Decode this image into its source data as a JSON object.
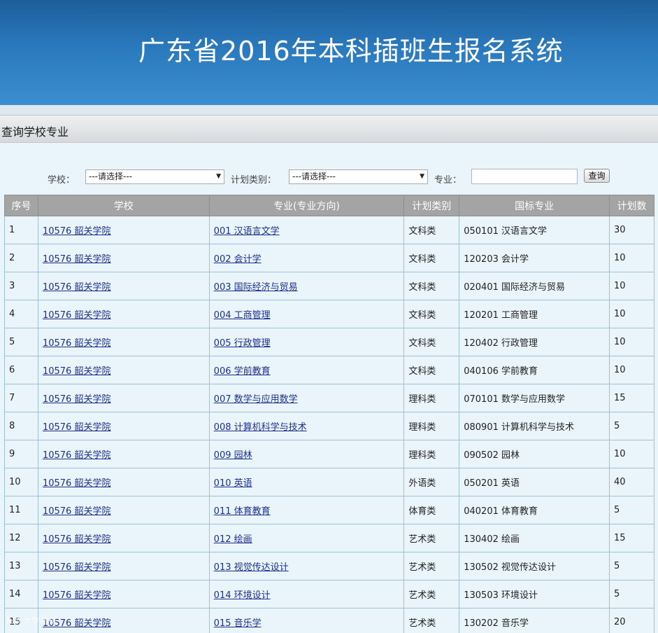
{
  "header": {
    "title": "广东省2016年本科插班生报名系统"
  },
  "section": {
    "title": "查询学校专业"
  },
  "search": {
    "school_label": "学校：",
    "school_value": "---请选择---",
    "plan_type_label": "计划类别：",
    "plan_type_value": "---请选择---",
    "major_label": "专业：",
    "major_value": "",
    "query_button": "查询"
  },
  "table": {
    "columns": [
      "序号",
      "学校",
      "专业(专业方向)",
      "计划类别",
      "国标专业",
      "计划数"
    ],
    "rows": [
      {
        "no": "1",
        "school": "10576 韶关学院",
        "major": "001 汉语言文学",
        "category": "文科类",
        "national": "050101 汉语言文学",
        "plan": "30"
      },
      {
        "no": "2",
        "school": "10576 韶关学院",
        "major": "002 会计学",
        "category": "文科类",
        "national": "120203 会计学",
        "plan": "10"
      },
      {
        "no": "3",
        "school": "10576 韶关学院",
        "major": "003 国际经济与贸易",
        "category": "文科类",
        "national": "020401 国际经济与贸易",
        "plan": "10"
      },
      {
        "no": "4",
        "school": "10576 韶关学院",
        "major": "004 工商管理",
        "category": "文科类",
        "national": "120201 工商管理",
        "plan": "10"
      },
      {
        "no": "5",
        "school": "10576 韶关学院",
        "major": "005 行政管理",
        "category": "文科类",
        "national": "120402 行政管理",
        "plan": "10"
      },
      {
        "no": "6",
        "school": "10576 韶关学院",
        "major": "006 学前教育",
        "category": "文科类",
        "national": "040106 学前教育",
        "plan": "10"
      },
      {
        "no": "7",
        "school": "10576 韶关学院",
        "major": "007 数学与应用数学",
        "category": "理科类",
        "national": "070101 数学与应用数学",
        "plan": "15"
      },
      {
        "no": "8",
        "school": "10576 韶关学院",
        "major": "008 计算机科学与技术",
        "category": "理科类",
        "national": "080901 计算机科学与技术",
        "plan": "5"
      },
      {
        "no": "9",
        "school": "10576 韶关学院",
        "major": "009 园林",
        "category": "理科类",
        "national": "090502 园林",
        "plan": "10"
      },
      {
        "no": "10",
        "school": "10576 韶关学院",
        "major": "010 英语",
        "category": "外语类",
        "national": "050201 英语",
        "plan": "40"
      },
      {
        "no": "11",
        "school": "10576 韶关学院",
        "major": "011 体育教育",
        "category": "体育类",
        "national": "040201 体育教育",
        "plan": "5"
      },
      {
        "no": "12",
        "school": "10576 韶关学院",
        "major": "012 绘画",
        "category": "艺术类",
        "national": "130402 绘画",
        "plan": "15"
      },
      {
        "no": "13",
        "school": "10576 韶关学院",
        "major": "013 视觉传达设计",
        "category": "艺术类",
        "national": "130502 视觉传达设计",
        "plan": "5"
      },
      {
        "no": "14",
        "school": "10576 韶关学院",
        "major": "014 环境设计",
        "category": "艺术类",
        "national": "130503 环境设计",
        "plan": "5"
      },
      {
        "no": "15",
        "school": "10576 韶关学院",
        "major": "015 音乐学",
        "category": "艺术类",
        "national": "130202 音乐学",
        "plan": "20"
      }
    ]
  },
  "watermark": {
    "text": "头条 大学·考研"
  }
}
